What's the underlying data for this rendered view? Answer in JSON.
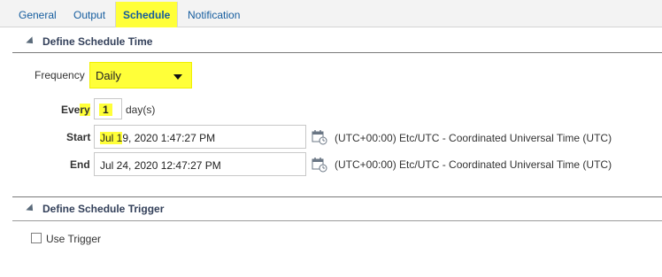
{
  "tabs": [
    {
      "label": "General"
    },
    {
      "label": "Output"
    },
    {
      "label": "Schedule"
    },
    {
      "label": "Notification"
    }
  ],
  "schedule_time": {
    "title": "Define Schedule Time",
    "frequency_label": "Frequency",
    "frequency_value": "Daily",
    "every_label_a": "Eve",
    "every_label_b": "ry",
    "every_value": "1",
    "every_unit": "day(s)",
    "start_label": "Start",
    "start_value_a": "Jul 1",
    "start_value_b": "9, 2020 1:47:27 PM",
    "end_label": "End",
    "end_value": "Jul 24, 2020 12:47:27 PM",
    "timezone_start": "(UTC+00:00) Etc/UTC - Coordinated Universal Time (UTC)",
    "timezone_end": "(UTC+00:00) Etc/UTC - Coordinated Universal Time (UTC)"
  },
  "schedule_trigger": {
    "title": "Define Schedule Trigger",
    "use_trigger_label": "Use Trigger",
    "use_trigger_checked": false
  },
  "colors": {
    "highlight": "#ffff39",
    "link": "#145c9e"
  }
}
